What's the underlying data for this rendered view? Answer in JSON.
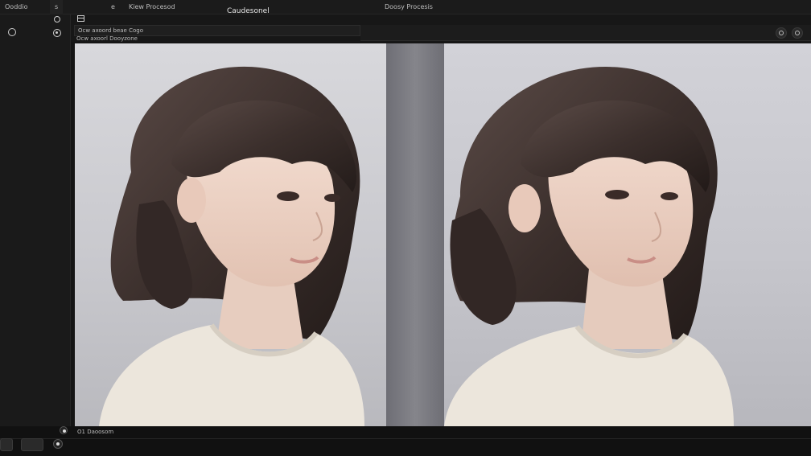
{
  "titlebar": {
    "tabs": [
      {
        "label": "Ooddio"
      },
      {
        "label": "s"
      },
      {
        "label": "e"
      },
      {
        "label": "Kiew Procesod"
      },
      {
        "label": "Doosy Procesis"
      }
    ],
    "title": "Caudesonel"
  },
  "sidebar": {
    "icons": [
      "refresh-icon",
      "radio-icon",
      "settings-icon",
      "grid-icon"
    ]
  },
  "toolbar": {
    "path_text": "Ocw axoord beae Cogo",
    "subheading": "Ocw axoorl Dooyzone"
  },
  "statusbar": {
    "text": "O1 Daoosom"
  },
  "colors": {
    "background": "#151515",
    "panel": "#1a1a1a",
    "backdrop_left": "#d3d3d7",
    "backdrop_right": "#cbcbd1",
    "hair": "#3b2f2c",
    "skin": "#f0d6c9",
    "sweater": "#ece6dc"
  }
}
